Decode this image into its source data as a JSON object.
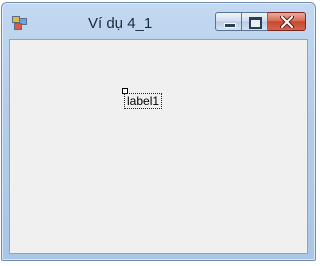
{
  "window": {
    "title": "Ví dụ 4_1",
    "app_icon": "form-icon",
    "caption_buttons": [
      {
        "name": "minimize",
        "icon": "minimize-icon"
      },
      {
        "name": "maximize",
        "icon": "maximize-icon"
      },
      {
        "name": "close",
        "icon": "close-icon"
      }
    ]
  },
  "form": {
    "label_text": "label1"
  },
  "colors": {
    "client_area": "#f0f0f0",
    "frame": "#b5cde9",
    "close_button": "#c74a31"
  }
}
